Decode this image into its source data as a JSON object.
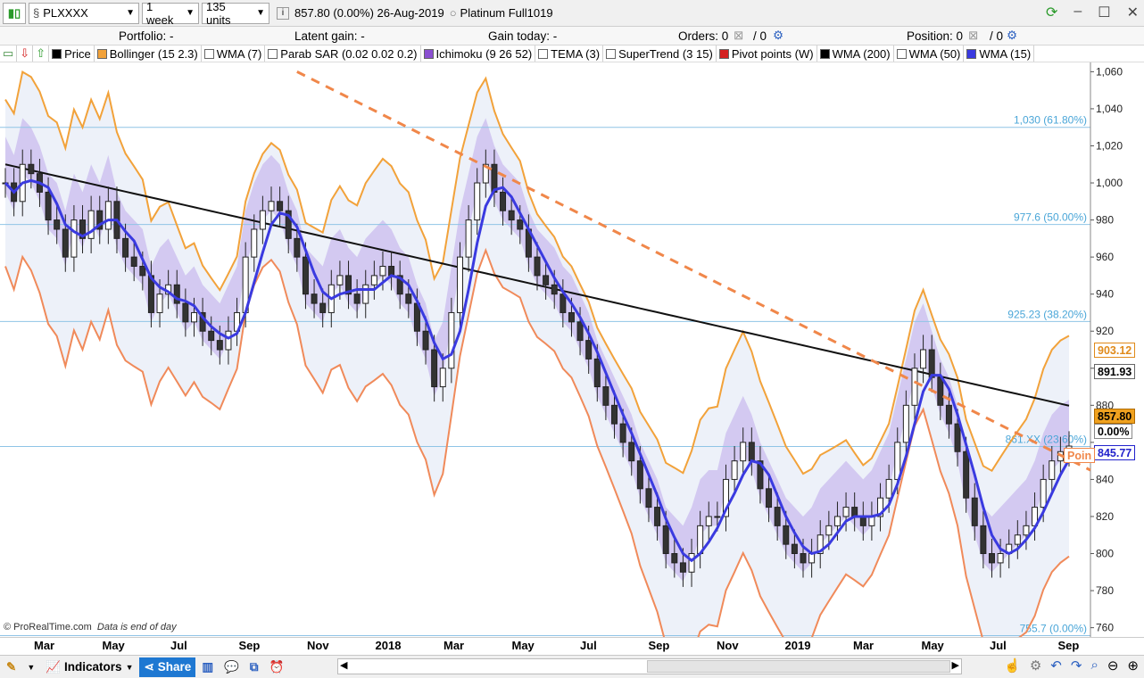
{
  "toolbar": {
    "symbol": "PLXXXX",
    "period": "1 week",
    "units": "135 units",
    "quote": "857.80 (0.00%) 26-Aug-2019",
    "platform": "Platinum Full1019"
  },
  "portfolio": {
    "portfolio": "Portfolio: -",
    "latent": "Latent gain: -",
    "gain_today": "Gain today: -",
    "orders": "Orders: 0",
    "orders2": "/ 0",
    "position": "Position: 0",
    "position2": "/ 0"
  },
  "indicators": [
    {
      "label": "Price",
      "color": "#000000"
    },
    {
      "label": "Bollinger (15 2.3)",
      "color": "#f2a23a"
    },
    {
      "label": "WMA (7)",
      "color": "#ffffff"
    },
    {
      "label": "Parab SAR (0.02 0.02 0.2)",
      "color": "#ffffff"
    },
    {
      "label": "Ichimoku (9 26 52)",
      "color": "#8a4fd1"
    },
    {
      "label": "TEMA (3)",
      "color": "#ffffff"
    },
    {
      "label": "SuperTrend (3 15)",
      "color": "#ffffff"
    },
    {
      "label": "Pivot points (W)",
      "color": "#d42020"
    },
    {
      "label": "WMA (200)",
      "color": "#000000"
    },
    {
      "label": "WMA (50)",
      "color": "#ffffff"
    },
    {
      "label": "WMA (15)",
      "color": "#3a3ae0"
    }
  ],
  "chart_data": {
    "type": "candlestick",
    "ylim": [
      755,
      1065
    ],
    "y_ticks": [
      760,
      780,
      800,
      820,
      840,
      860,
      880,
      900,
      920,
      940,
      960,
      980,
      1000,
      1020,
      1040,
      1060
    ],
    "y_tick_labels": [
      "760",
      "780",
      "800",
      "820",
      "840",
      "",
      "880",
      "900",
      "920",
      "940",
      "960",
      "980",
      "1,000",
      "1,020",
      "1,040",
      "1,060"
    ],
    "x_labels": [
      "Mar",
      "May",
      "Jul",
      "Sep",
      "Nov",
      "2018",
      "Mar",
      "May",
      "Jul",
      "Sep",
      "Nov",
      "2019",
      "Mar",
      "May",
      "Jul",
      "Sep"
    ],
    "fib_levels": [
      {
        "value": 1030,
        "label": "1,030 (61.80%)"
      },
      {
        "value": 977.6,
        "label": "977.6 (50.00%)"
      },
      {
        "value": 925.23,
        "label": "925.23 (38.20%)"
      },
      {
        "value": 857.8,
        "label": "861.XX (23.60%)"
      },
      {
        "value": 755.7,
        "label": "755.7 (0.00%)"
      }
    ],
    "close_series": [
      1000,
      990,
      1010,
      1005,
      995,
      980,
      975,
      960,
      980,
      970,
      985,
      975,
      990,
      970,
      960,
      955,
      950,
      930,
      940,
      945,
      935,
      925,
      930,
      920,
      915,
      910,
      920,
      930,
      960,
      975,
      985,
      990,
      985,
      970,
      960,
      940,
      935,
      930,
      945,
      950,
      940,
      935,
      945,
      950,
      955,
      950,
      940,
      935,
      920,
      910,
      890,
      900,
      930,
      960,
      980,
      1000,
      1010,
      995,
      985,
      980,
      975,
      960,
      950,
      945,
      940,
      930,
      925,
      915,
      905,
      890,
      880,
      870,
      860,
      850,
      835,
      825,
      815,
      800,
      795,
      790,
      800,
      815,
      820,
      820,
      840,
      850,
      860,
      850,
      835,
      825,
      815,
      805,
      800,
      795,
      800,
      810,
      815,
      820,
      825,
      820,
      815,
      820,
      830,
      840,
      860,
      880,
      900,
      910,
      895,
      880,
      870,
      855,
      830,
      815,
      800,
      795,
      800,
      805,
      810,
      815,
      825,
      840,
      850,
      855,
      858
    ],
    "wma200_label": "891.93",
    "tags": [
      {
        "label": "903.12",
        "bg": "#ffffff",
        "color": "#e08a1a",
        "border": "#e08a1a"
      },
      {
        "label": "891.93",
        "bg": "#ffffff",
        "color": "#000000",
        "border": "#666666"
      },
      {
        "label": "857.80",
        "bg": "#f0a21f",
        "color": "#000000",
        "border": "#b06a00"
      },
      {
        "label": "0.00%",
        "bg": "#ffffff",
        "color": "#000000",
        "border": "#888888"
      },
      {
        "label": "845.77",
        "bg": "#ffffff",
        "color": "#2222cc",
        "border": "#2222cc"
      }
    ],
    "pivot_label": "Poin"
  },
  "footer": {
    "copyright": "© ProRealTime.com",
    "note": "Data is end of day",
    "indicators": "Indicators",
    "share": "Share"
  }
}
